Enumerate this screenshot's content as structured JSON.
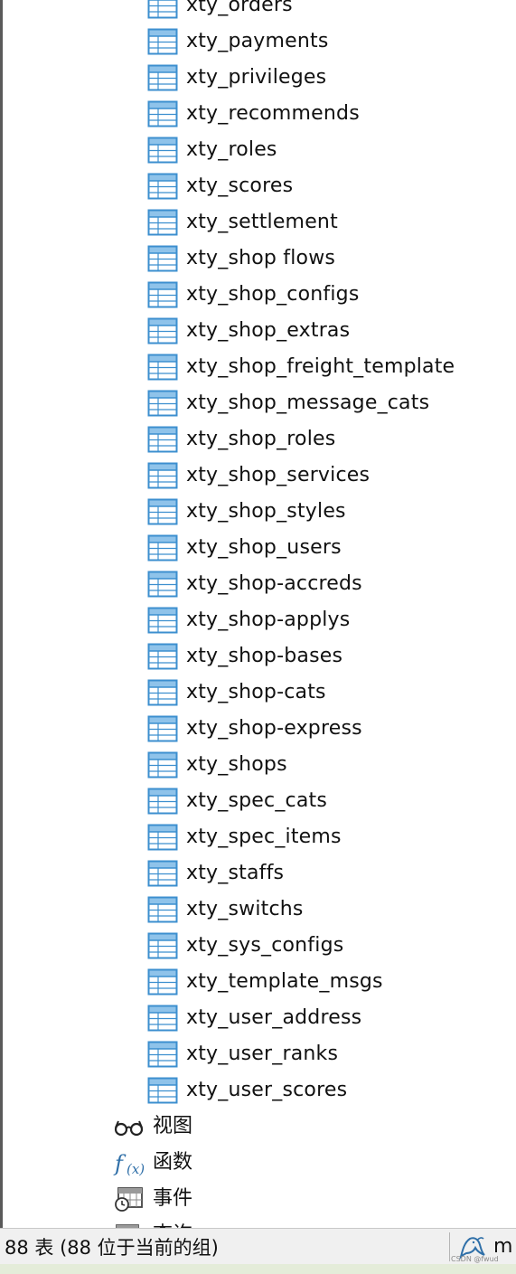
{
  "navigator": {
    "tables": [
      "xty_orders",
      "xty_payments",
      "xty_privileges",
      "xty_recommends",
      "xty_roles",
      "xty_scores",
      "xty_settlement",
      "xty_shop flows",
      "xty_shop_configs",
      "xty_shop_extras",
      "xty_shop_freight_template",
      "xty_shop_message_cats",
      "xty_shop_roles",
      "xty_shop_services",
      "xty_shop_styles",
      "xty_shop_users",
      "xty_shop-accreds",
      "xty_shop-applys",
      "xty_shop-bases",
      "xty_shop-cats",
      "xty_shop-express",
      "xty_shops",
      "xty_spec_cats",
      "xty_spec_items",
      "xty_staffs",
      "xty_switchs",
      "xty_sys_configs",
      "xty_template_msgs",
      "xty_user_address",
      "xty_user_ranks",
      "xty_user_scores"
    ],
    "groups": [
      {
        "label": "视图",
        "icon": "view-glasses-icon"
      },
      {
        "label": "函数",
        "icon": "function-icon"
      },
      {
        "label": "事件",
        "icon": "event-calendar-icon"
      },
      {
        "label": "查询",
        "icon": "query-icon"
      }
    ]
  },
  "statusbar": {
    "text": "88 表 (88 位于当前的组)",
    "connection_label": "m",
    "connection_icon": "mysql-dolphin-icon"
  },
  "watermark": "CSDN @fwud",
  "colors": {
    "table_icon_blue": "#3c8fcf",
    "table_icon_header": "#8fc3ea",
    "statusbar_bg": "#f0f0f0",
    "bottom_strip": "#e4ecd9"
  }
}
